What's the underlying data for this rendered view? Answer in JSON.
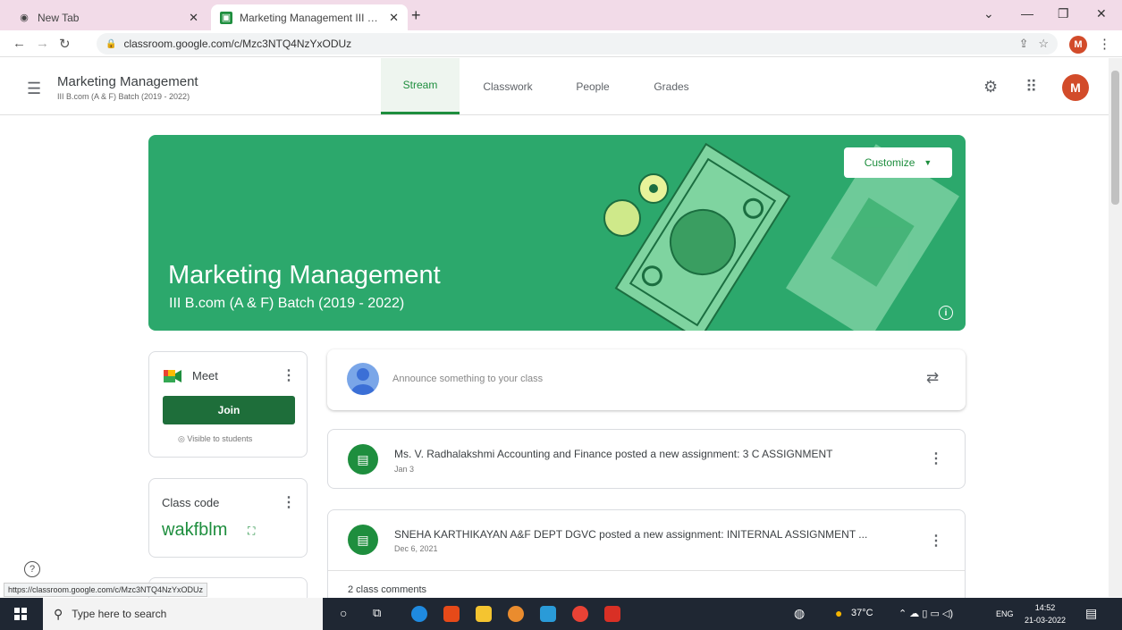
{
  "browser": {
    "tabs": [
      {
        "label": "New Tab",
        "icon": "chrome-newtab-icon"
      },
      {
        "label": "Marketing Management III B.com",
        "icon": "classroom-icon"
      }
    ],
    "url": "classroom.google.com/c/Mzc3NTQ4NzYxODUz",
    "profile_initial": "M"
  },
  "header": {
    "title": "Marketing Management",
    "subtitle": "III B.com (A & F) Batch (2019 - 2022)",
    "nav": [
      "Stream",
      "Classwork",
      "People",
      "Grades"
    ],
    "active_tab": "Stream",
    "avatar_initial": "M"
  },
  "banner": {
    "title": "Marketing Management",
    "subtitle": "III B.com (A & F) Batch (2019 - 2022)",
    "customize_label": "Customize",
    "bg_color": "#2ca86c"
  },
  "meet": {
    "title": "Meet",
    "join_label": "Join",
    "visibility": "Visible to students"
  },
  "class_code": {
    "label": "Class code",
    "code": "wakfblm"
  },
  "announce": {
    "placeholder": "Announce something to your class"
  },
  "posts": [
    {
      "title": "Ms. V. Radhalakshmi Accounting and Finance posted a new assignment: 3 C ASSIGNMENT",
      "date": "Jan 3"
    },
    {
      "title": "SNEHA KARTHIKAYAN A&F DEPT DGVC posted a new assignment: INITERNAL ASSIGNMENT ...",
      "date": "Dec 6, 2021",
      "comments": "2 class comments"
    }
  ],
  "status_link": "https://classroom.google.com/c/Mzc3NTQ4NzYxODUz",
  "taskbar": {
    "search_placeholder": "Type here to search",
    "weather": "37°C",
    "language": "ENG",
    "time": "14:52",
    "date": "21-03-2022"
  }
}
